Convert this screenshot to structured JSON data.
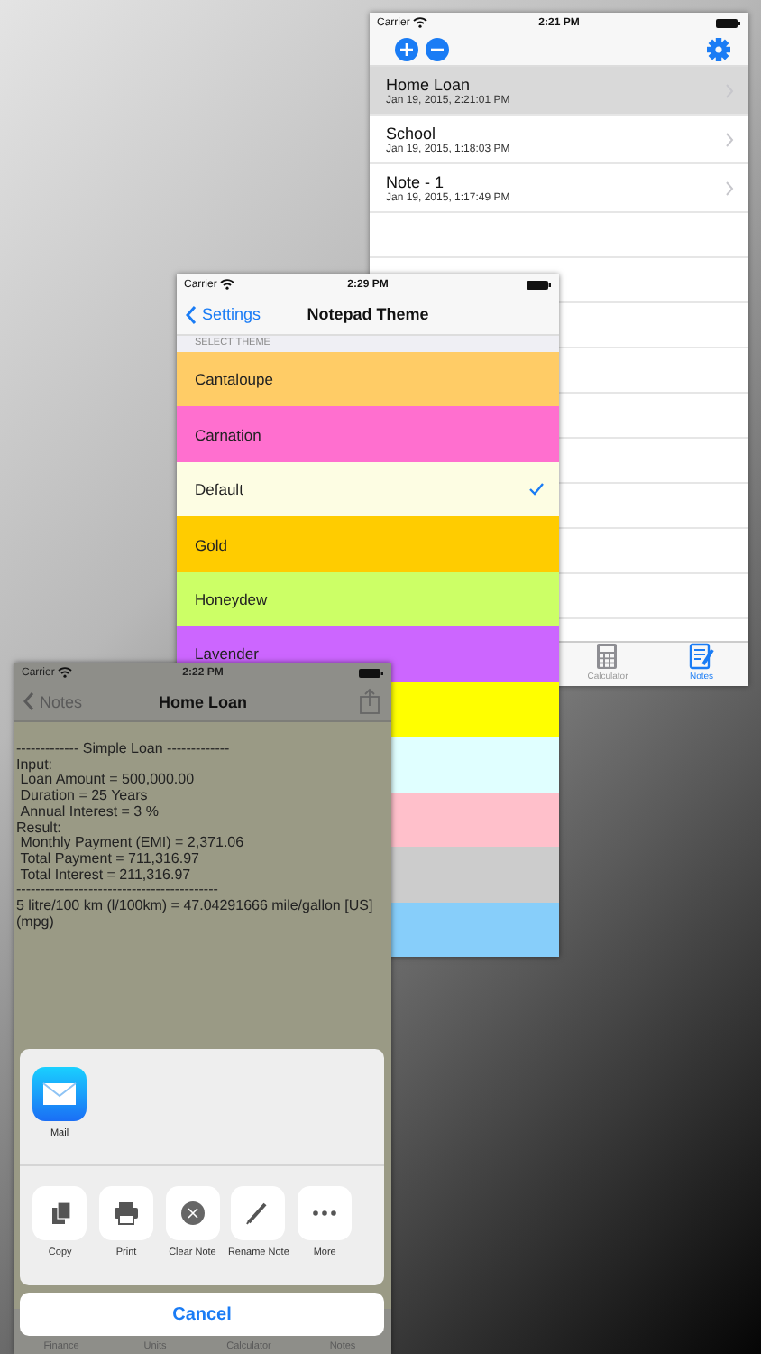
{
  "notes_list": {
    "status_bar": {
      "carrier": "Carrier",
      "time": "2:21 PM"
    },
    "notes": [
      {
        "title": "Home Loan",
        "date": "Jan 19, 2015, 2:21:01 PM",
        "selected": true
      },
      {
        "title": "School",
        "date": "Jan 19, 2015, 1:18:03 PM",
        "selected": false
      },
      {
        "title": "Note - 1",
        "date": "Jan 19, 2015, 1:17:49 PM",
        "selected": false
      }
    ],
    "tabs": [
      {
        "label": "Calculator",
        "kind": "calculator",
        "selected": false
      },
      {
        "label": "Notes",
        "kind": "notes",
        "selected": true
      }
    ]
  },
  "theme_settings": {
    "status_bar": {
      "carrier": "Carrier",
      "time": "2:29 PM"
    },
    "back": "Settings",
    "title": "Notepad Theme",
    "section_header": "SELECT THEME",
    "themes": [
      {
        "label": "Cantaloupe",
        "color": "#ffcc66",
        "checked": false
      },
      {
        "label": "Carnation",
        "color": "#ff6fcf",
        "checked": false
      },
      {
        "label": "Default",
        "color": "#fdfde3",
        "checked": true
      },
      {
        "label": "Gold",
        "color": "#ffcc00",
        "checked": false
      },
      {
        "label": "Honeydew",
        "color": "#ccff66",
        "checked": false
      },
      {
        "label": "Lavender",
        "color": "#cc66ff",
        "checked": false
      },
      {
        "color": "#ffff00"
      },
      {
        "color": "#e0ffff"
      },
      {
        "color": "#ffc0cb"
      },
      {
        "color": "#cccccc"
      },
      {
        "color": "#87cefa"
      }
    ]
  },
  "note": {
    "status_bar": {
      "carrier": "Carrier",
      "time": "2:22 PM"
    },
    "back": "Notes",
    "title": "Home Loan",
    "body_lines": [
      "------------- Simple Loan -------------",
      "Input:",
      " Loan Amount = 500,000.00",
      " Duration = 25 Years",
      " Annual Interest = 3 %",
      "Result:",
      " Monthly Payment (EMI) = 2,371.06",
      " Total Payment = 711,316.97",
      " Total Interest = 211,316.97",
      "------------------------------------------",
      "5 litre/100 km (l/100km) = 47.04291666 mile/gallon [US] (mpg)"
    ],
    "share_sheet": {
      "apps": [
        {
          "label": "Mail"
        }
      ],
      "actions": [
        {
          "kind": "copy",
          "label": "Copy"
        },
        {
          "kind": "print",
          "label": "Print"
        },
        {
          "kind": "clear",
          "label": "Clear Note"
        },
        {
          "kind": "rename",
          "label": "Rename Note"
        },
        {
          "kind": "more",
          "label": "More"
        }
      ],
      "cancel": "Cancel"
    },
    "tabs": [
      {
        "label": "Finance"
      },
      {
        "label": "Units"
      },
      {
        "label": "Calculator"
      },
      {
        "label": "Notes"
      }
    ]
  }
}
